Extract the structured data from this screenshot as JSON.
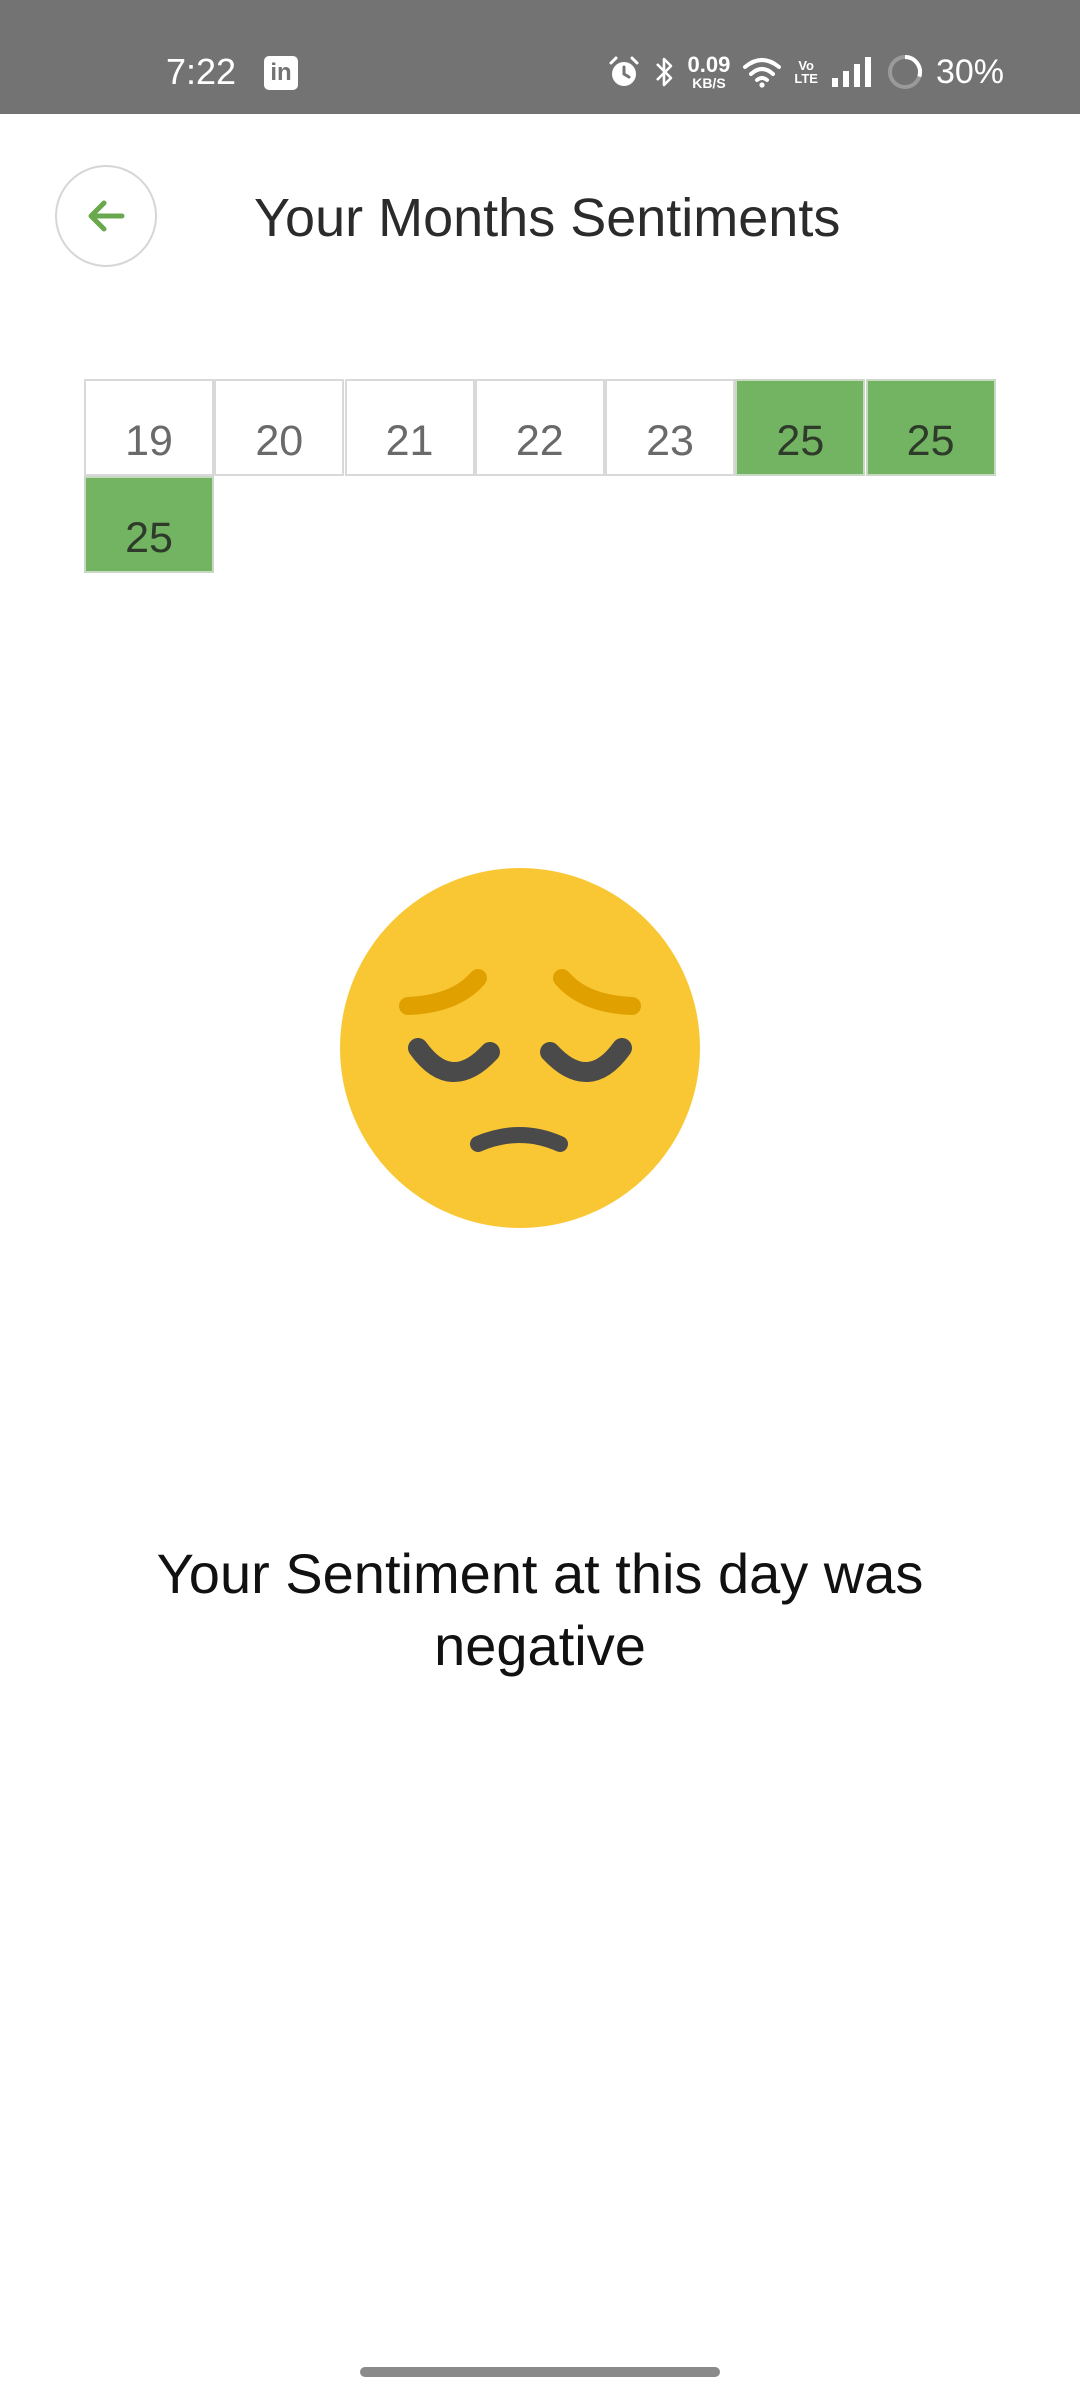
{
  "status_bar": {
    "time": "7:22",
    "app_icon_label": "in",
    "net_speed_value": "0.09",
    "net_speed_unit": "KB/S",
    "volte_top": "Vo",
    "volte_bottom": "LTE",
    "battery_percent": "30%"
  },
  "header": {
    "title": "Your Months Sentiments"
  },
  "days": [
    {
      "label": "19",
      "marked": false
    },
    {
      "label": "20",
      "marked": false
    },
    {
      "label": "21",
      "marked": false
    },
    {
      "label": "22",
      "marked": false
    },
    {
      "label": "23",
      "marked": false
    },
    {
      "label": "25",
      "marked": true
    },
    {
      "label": "25",
      "marked": true
    },
    {
      "label": "25",
      "marked": true
    }
  ],
  "sentiment": {
    "emoji": "pensive-face-icon",
    "message": "Your Sentiment at this day was negative"
  },
  "colors": {
    "accent_green": "#72b462",
    "back_arrow_green": "#6aa84f",
    "status_bar_bg": "#737373",
    "emoji_yellow": "#f9c733"
  }
}
